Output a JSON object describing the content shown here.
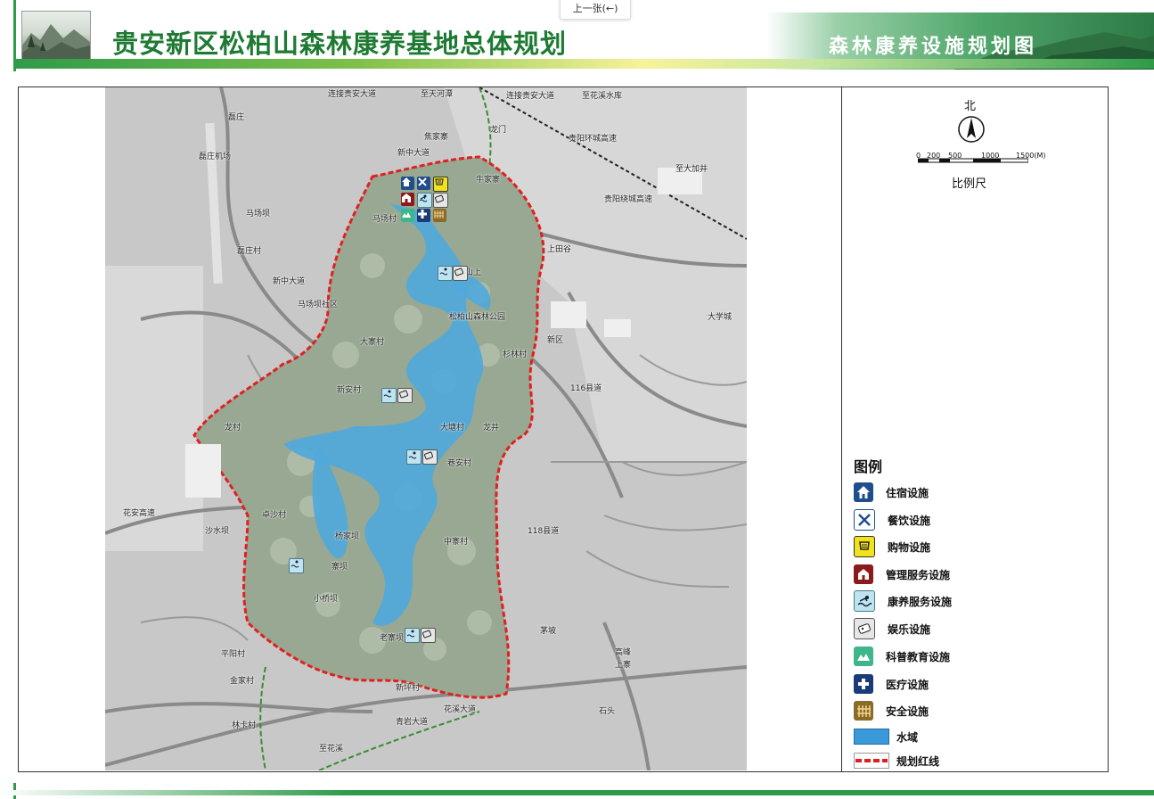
{
  "header": {
    "title": "贵安新区松柏山森林康养基地总体规划",
    "subtitle": "森林康养设施规划图",
    "prev_button": "上一张(←)"
  },
  "legend": {
    "north_label": "北",
    "scale_ticks": [
      "0",
      "200",
      "500",
      "1000",
      "1500(M)"
    ],
    "scale_caption": "比例尺",
    "title": "图例",
    "items": [
      {
        "key": "lodging",
        "label": "住宿设施",
        "icon": "house-icon",
        "color": "#1f4e8c"
      },
      {
        "key": "dining",
        "label": "餐饮设施",
        "icon": "fork-knife-icon",
        "color": "#1f4e8c"
      },
      {
        "key": "shopping",
        "label": "购物设施",
        "icon": "shopping-cart-icon",
        "color": "#f2e21b"
      },
      {
        "key": "management",
        "label": "管理服务设施",
        "icon": "management-house-icon",
        "color": "#8b1a1a"
      },
      {
        "key": "wellness",
        "label": "康养服务设施",
        "icon": "swimmer-icon",
        "color": "#bfe3ef"
      },
      {
        "key": "entertainment",
        "label": "娱乐设施",
        "icon": "game-icon",
        "color": "#e6e6e6"
      },
      {
        "key": "education",
        "label": "科普教育设施",
        "icon": "mountain-icon",
        "color": "#3fb58a"
      },
      {
        "key": "medical",
        "label": "医疗设施",
        "icon": "medical-cross-icon",
        "color": "#1a3a7a"
      },
      {
        "key": "safety",
        "label": "安全设施",
        "icon": "fence-icon",
        "color": "#8a6a2a"
      },
      {
        "key": "water",
        "label": "水域",
        "icon": "water-swatch",
        "color": "#3a9ad9"
      },
      {
        "key": "redline",
        "label": "规划红线",
        "icon": "red-dashed-line",
        "color": "#e02020"
      }
    ]
  },
  "map": {
    "places": [
      "连接贵安大道",
      "至天河潭",
      "连接贵安大道",
      "至花溪水库",
      "磊庄",
      "磊庄机场",
      "焦家寨",
      "新中大道",
      "龙门",
      "贵阳环城高速",
      "牛家寨",
      "至大加井",
      "马场坝",
      "贵阳绕城高速",
      "磊庄村",
      "新中大道",
      "马场坝社区",
      "松柏山森林公园",
      "大学城",
      "马场村",
      "上田谷",
      "山上",
      "新区",
      "大寨村",
      "杉林村",
      "新安村",
      "龙井",
      "116县道",
      "龙村",
      "大塘村",
      "巷安村",
      "卓沙村",
      "118县道",
      "中寨村",
      "沙水坝",
      "杨家坝",
      "寨坝",
      "小桥坝",
      "老寨坝",
      "茅坡",
      "平阳村",
      "金家村",
      "林卡村",
      "新坪村",
      "高峰",
      "上寨",
      "花溪大道",
      "石头",
      "青岩大道",
      "至花溪",
      "花安高速"
    ]
  }
}
